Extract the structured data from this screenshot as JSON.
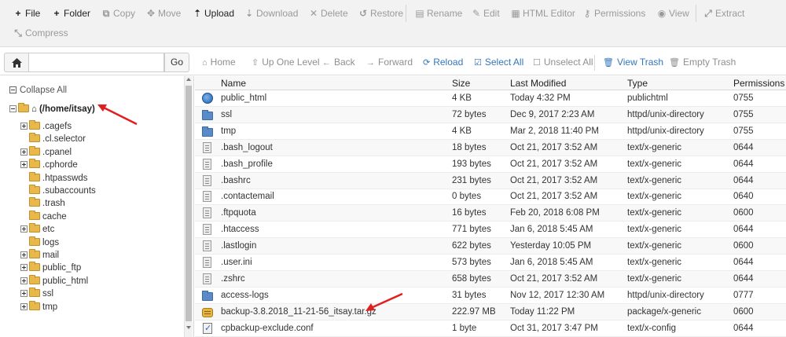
{
  "toolbar": {
    "file": "File",
    "folder": "Folder",
    "copy": "Copy",
    "move": "Move",
    "upload": "Upload",
    "download": "Download",
    "delete": "Delete",
    "restore": "Restore",
    "rename": "Rename",
    "edit": "Edit",
    "html_editor": "HTML Editor",
    "permissions": "Permissions",
    "view": "View",
    "extract": "Extract",
    "compress": "Compress"
  },
  "navbar": {
    "path_value": "",
    "go": "Go",
    "home": "Home",
    "up_one_level": "Up One Level",
    "back": "Back",
    "forward": "Forward",
    "reload": "Reload",
    "select_all": "Select All",
    "unselect_all": "Unselect All",
    "view_trash": "View Trash",
    "empty_trash": "Empty Trash"
  },
  "sidebar": {
    "collapse_all": "Collapse All",
    "root": "(/home/itsay)",
    "items": [
      {
        "name": ".cagefs",
        "expandable": true
      },
      {
        "name": ".cl.selector",
        "expandable": false
      },
      {
        "name": ".cpanel",
        "expandable": true
      },
      {
        "name": ".cphorde",
        "expandable": true
      },
      {
        "name": ".htpasswds",
        "expandable": false
      },
      {
        "name": ".subaccounts",
        "expandable": false
      },
      {
        "name": ".trash",
        "expandable": false
      },
      {
        "name": "cache",
        "expandable": false
      },
      {
        "name": "etc",
        "expandable": true
      },
      {
        "name": "logs",
        "expandable": false
      },
      {
        "name": "mail",
        "expandable": true
      },
      {
        "name": "public_ftp",
        "expandable": true
      },
      {
        "name": "public_html",
        "expandable": true
      },
      {
        "name": "ssl",
        "expandable": true
      },
      {
        "name": "tmp",
        "expandable": true
      }
    ]
  },
  "table": {
    "columns": {
      "name": "Name",
      "size": "Size",
      "last_modified": "Last Modified",
      "type": "Type",
      "permissions": "Permissions"
    },
    "rows": [
      {
        "icon": "globe-icon",
        "name": "public_html",
        "size": "4 KB",
        "modified": "Today 4:32 PM",
        "type": "publichtml",
        "perms": "0755"
      },
      {
        "icon": "folder-icon",
        "name": "ssl",
        "size": "72 bytes",
        "modified": "Dec 9, 2017 2:23 AM",
        "type": "httpd/unix-directory",
        "perms": "0755"
      },
      {
        "icon": "folder-icon",
        "name": "tmp",
        "size": "4 KB",
        "modified": "Mar 2, 2018 11:40 PM",
        "type": "httpd/unix-directory",
        "perms": "0755"
      },
      {
        "icon": "text-file-icon",
        "name": ".bash_logout",
        "size": "18 bytes",
        "modified": "Oct 21, 2017 3:52 AM",
        "type": "text/x-generic",
        "perms": "0644"
      },
      {
        "icon": "text-file-icon",
        "name": ".bash_profile",
        "size": "193 bytes",
        "modified": "Oct 21, 2017 3:52 AM",
        "type": "text/x-generic",
        "perms": "0644"
      },
      {
        "icon": "text-file-icon",
        "name": ".bashrc",
        "size": "231 bytes",
        "modified": "Oct 21, 2017 3:52 AM",
        "type": "text/x-generic",
        "perms": "0644"
      },
      {
        "icon": "text-file-icon",
        "name": ".contactemail",
        "size": "0 bytes",
        "modified": "Oct 21, 2017 3:52 AM",
        "type": "text/x-generic",
        "perms": "0640"
      },
      {
        "icon": "text-file-icon",
        "name": ".ftpquota",
        "size": "16 bytes",
        "modified": "Feb 20, 2018 6:08 PM",
        "type": "text/x-generic",
        "perms": "0600"
      },
      {
        "icon": "text-file-icon",
        "name": ".htaccess",
        "size": "771 bytes",
        "modified": "Jan 6, 2018 5:45 AM",
        "type": "text/x-generic",
        "perms": "0644"
      },
      {
        "icon": "text-file-icon",
        "name": ".lastlogin",
        "size": "622 bytes",
        "modified": "Yesterday 10:05 PM",
        "type": "text/x-generic",
        "perms": "0600"
      },
      {
        "icon": "text-file-icon",
        "name": ".user.ini",
        "size": "573 bytes",
        "modified": "Jan 6, 2018 5:45 AM",
        "type": "text/x-generic",
        "perms": "0644"
      },
      {
        "icon": "text-file-icon",
        "name": ".zshrc",
        "size": "658 bytes",
        "modified": "Oct 21, 2017 3:52 AM",
        "type": "text/x-generic",
        "perms": "0644"
      },
      {
        "icon": "folder-icon",
        "name": "access-logs",
        "size": "31 bytes",
        "modified": "Nov 12, 2017 12:30 AM",
        "type": "httpd/unix-directory",
        "perms": "0777"
      },
      {
        "icon": "archive-icon",
        "name": "backup-3.8.2018_11-21-56_itsay.tar.gz",
        "size": "222.97 MB",
        "modified": "Today 11:22 PM",
        "type": "package/x-generic",
        "perms": "0600"
      },
      {
        "icon": "config-file-icon",
        "name": "cpbackup-exclude.conf",
        "size": "1 byte",
        "modified": "Oct 31, 2017 3:47 PM",
        "type": "text/x-config",
        "perms": "0644"
      }
    ]
  },
  "colors": {
    "accent_blue": "#3476bb",
    "annotation_red": "#e02020",
    "folder_yellow": "#e8b94a",
    "folder_blue": "#5a8ac8"
  }
}
